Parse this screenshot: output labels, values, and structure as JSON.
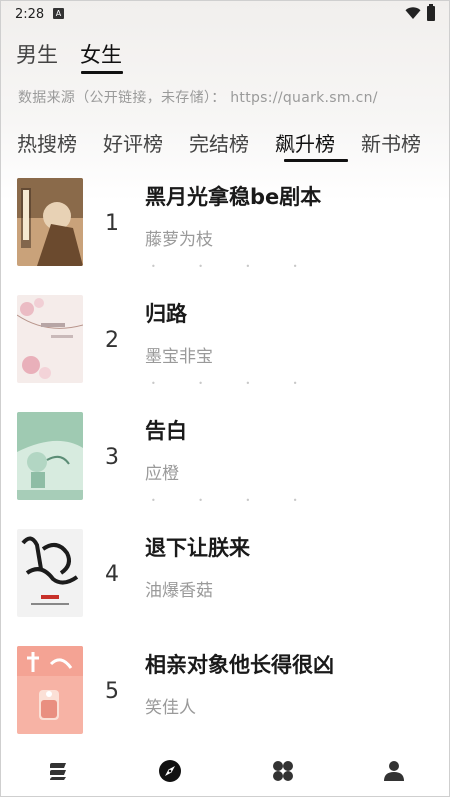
{
  "status": {
    "time": "2:28",
    "notif_icon": "A"
  },
  "gender_tabs": [
    {
      "label": "男生",
      "active": false
    },
    {
      "label": "女生",
      "active": true
    }
  ],
  "source_text": "数据来源（公开链接，未存储）： https://quark.sm.cn/",
  "rank_tabs": [
    {
      "label": "热搜榜",
      "active": false
    },
    {
      "label": "好评榜",
      "active": false
    },
    {
      "label": "完结榜",
      "active": false
    },
    {
      "label": "飙升榜",
      "active": true
    },
    {
      "label": "新书榜",
      "active": false
    }
  ],
  "books": [
    {
      "rank": "1",
      "title": "黑月光拿稳be剧本",
      "author": "藤萝为枝",
      "cover_colors": [
        "#6b4a2e",
        "#c9a27a",
        "#3b2a1e"
      ]
    },
    {
      "rank": "2",
      "title": "归路",
      "author": "墨宝非宝",
      "cover_colors": [
        "#f3e6e3",
        "#e7b7bf",
        "#ffffff"
      ]
    },
    {
      "rank": "3",
      "title": "告白",
      "author": "应橙",
      "cover_colors": [
        "#b9d8c9",
        "#7fb59c",
        "#e9f2ea"
      ]
    },
    {
      "rank": "4",
      "title": "退下让朕来",
      "author": "油爆香菇",
      "cover_colors": [
        "#f2f2f2",
        "#1c1c1c",
        "#c8312a"
      ]
    },
    {
      "rank": "5",
      "title": "相亲对象他长得很凶",
      "author": "笑佳人",
      "cover_colors": [
        "#f7b3a5",
        "#fbe0d6",
        "#e57a6a"
      ]
    }
  ],
  "bottom_nav": [
    {
      "icon": "bookshelf-icon"
    },
    {
      "icon": "compass-icon"
    },
    {
      "icon": "category-icon"
    },
    {
      "icon": "profile-icon"
    }
  ]
}
